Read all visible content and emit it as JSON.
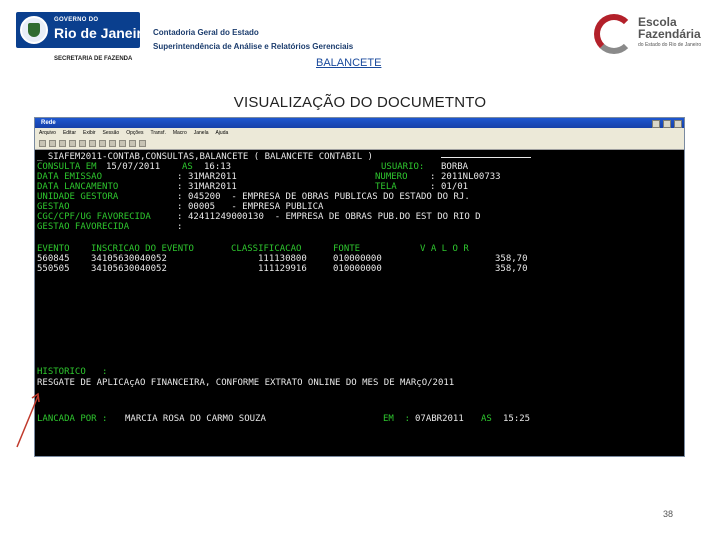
{
  "header": {
    "gov_line1": "GOVERNO DO",
    "gov_line2": "Rio de Janeiro",
    "gov_sub": "SECRETARIA DE FAZENDA",
    "dept_line1": "Contadoria Geral do Estado",
    "dept_line2": "Superintendência de Análise e Relatórios Gerenciais",
    "link": "BALANCETE",
    "ef_line1": "Escola",
    "ef_line2": "Fazendária",
    "ef_line3": "do Estado do Rio de Janeiro"
  },
  "slide_title": "VISUALIZAÇÃO DO DOCUMETNTO",
  "window": {
    "title": "Rede",
    "menu": [
      "Arquivo",
      "Editar",
      "Exibir",
      "Sessão",
      "Opções",
      "Transf.",
      "Macro",
      "Janela",
      "Ajuda"
    ]
  },
  "terminal": {
    "cmd": "_ SIAFEM2011-CONTAB,CONSULTAS,BALANCETE ( BALANCETE CONTABIL )",
    "consulta_label": "CONSULTA EM",
    "consulta_value": "15/07/2011",
    "as_label": "AS",
    "time_value": "16:13",
    "usuario_label": "USUARIO:",
    "usuario_value": "BORBA",
    "data_emissao_label": "DATA EMISSAO",
    "data_emissao_value": "31MAR2011",
    "numero_label": "NUMERO",
    "numero_value": "2011NL00733",
    "data_lancamento_label": "DATA LANCAMENTO",
    "data_lancamento_value": "31MAR2011",
    "tela_label": "TELA",
    "tela_value": "01/01",
    "ug_label": "UNIDADE GESTORA",
    "ug_value": "045200  - EMPRESA DE OBRAS PUBLICAS DO ESTADO DO RJ.",
    "gestao_label": "GESTAO",
    "gestao_value": "00005   - EMPRESA PUBLICA",
    "cgc_label": "CGC/CPF/UG FAVORECIDA",
    "cgc_value": "42411249000130  - EMPRESA DE OBRAS PUB.DO EST DO RIO D",
    "gestao_fav_label": "GESTAO FAVORECIDA",
    "col_evento": "EVENTO",
    "col_inscricao": "INSCRICAO DO EVENTO",
    "col_classificacao": "CLASSIFICACAO",
    "col_fonte": "FONTE",
    "col_valor": "V A L O R",
    "rows": [
      {
        "evento": "560845",
        "inscricao": "34105630040052",
        "classificacao": "111130800",
        "fonte": "010000000",
        "valor": "358,70"
      },
      {
        "evento": "550505",
        "inscricao": "34105630040052",
        "classificacao": "111129916",
        "fonte": "010000000",
        "valor": "358,70"
      }
    ],
    "historico_label": "HISTORICO   :",
    "historico_text": "RESGATE DE APLICAçAO FINANCEIRA, CONFORME EXTRATO ONLINE DO MES DE MARçO/2011",
    "lancada_label": "LANCADA POR :",
    "lancada_value": "MARCIA ROSA DO CARMO SOUZA",
    "em_label": "EM  :",
    "em_value": "07ABR2011",
    "as2_label": "AS",
    "time2_value": "15:25"
  },
  "page_number": "38",
  "colors": {
    "terminal_green": "#2ec62e",
    "terminal_white": "#e8e8e8",
    "link_blue": "#1a4a9c",
    "gov_blue": "#0a3f8e"
  }
}
